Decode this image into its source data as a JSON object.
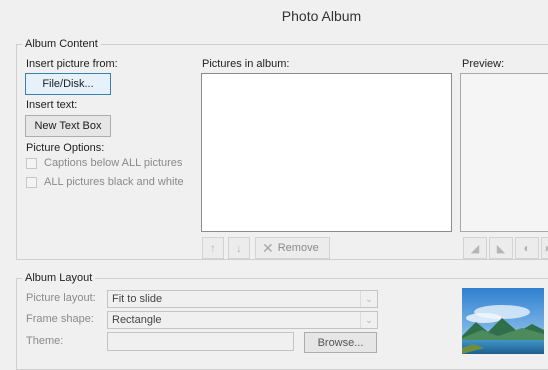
{
  "window": {
    "title": "Photo Album"
  },
  "album_content": {
    "legend": "Album Content",
    "insert_picture_label": "Insert picture from:",
    "file_disk_button": "File/Disk...",
    "insert_text_label": "Insert text:",
    "new_text_box_button": "New Text Box",
    "picture_options_label": "Picture Options:",
    "captions_label": "Captions below ALL pictures",
    "black_white_label": "ALL pictures black and white",
    "pictures_in_album_label": "Pictures in album:",
    "remove_button": "Remove",
    "preview_label": "Preview:"
  },
  "album_layout": {
    "legend": "Album Layout",
    "picture_layout_label": "Picture layout:",
    "picture_layout_value": "Fit to slide",
    "frame_shape_label": "Frame shape:",
    "frame_shape_value": "Rectangle",
    "theme_label": "Theme:",
    "theme_value": "",
    "browse_button": "Browse..."
  }
}
